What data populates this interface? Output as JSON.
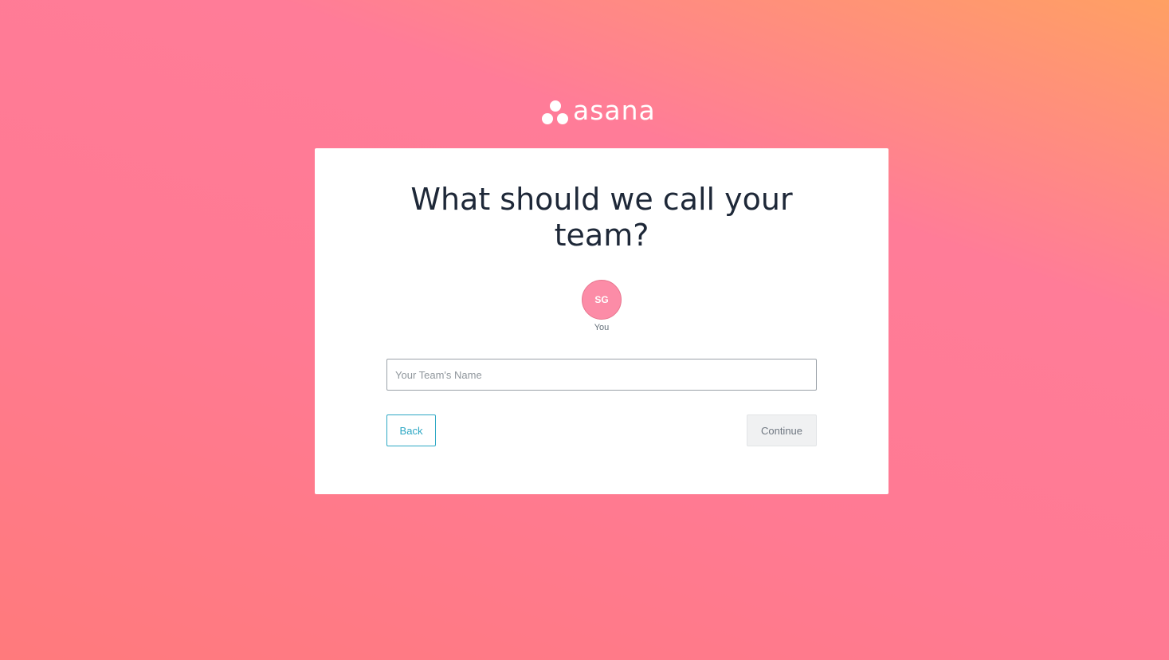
{
  "brand": {
    "logo_icon": "asana-dots-icon",
    "name": "asana"
  },
  "card": {
    "title_line1": "What should we call your",
    "title_line2": "team?",
    "avatar": {
      "initials": "SG",
      "label": "You",
      "color": "#fc8ca7"
    },
    "team_name_input": {
      "value": "",
      "placeholder": "Your Team's Name"
    },
    "back_label": "Back",
    "continue_label": "Continue"
  },
  "colors": {
    "background_gradient": [
      "#ffa063",
      "#ff7c98",
      "#ff7a7c"
    ],
    "accent": "#2ca7c4",
    "card": "#ffffff",
    "title_text": "#1e2838"
  }
}
